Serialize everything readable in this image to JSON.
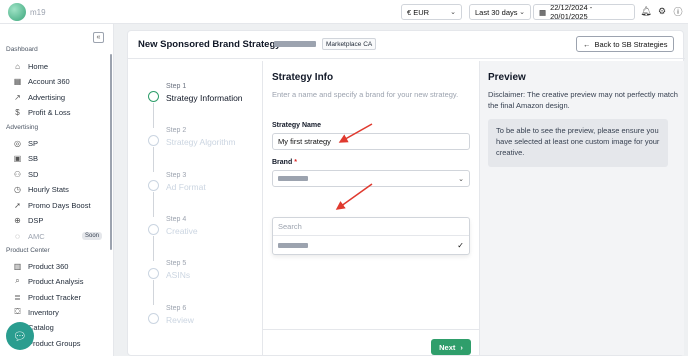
{
  "topbar": {
    "logo_text": "m19",
    "currency": "€ EUR",
    "date_range_preset": "Last 30 days",
    "date_range": "22/12/2024 - 20/01/2025"
  },
  "sidebar": {
    "collapse_icon": "«",
    "sections": [
      {
        "label": "Dashboard",
        "items": [
          {
            "label": "Home",
            "icon": "home-icon",
            "glyph": "⌂"
          },
          {
            "label": "Account 360",
            "icon": "grid-icon",
            "glyph": "▦"
          },
          {
            "label": "Advertising",
            "icon": "trend-icon",
            "glyph": "↗"
          },
          {
            "label": "Profit & Loss",
            "icon": "dollar-icon",
            "glyph": "$"
          }
        ]
      },
      {
        "label": "Advertising",
        "items": [
          {
            "label": "SP",
            "icon": "target-icon",
            "glyph": "◎"
          },
          {
            "label": "SB",
            "icon": "sb-icon",
            "glyph": "▣"
          },
          {
            "label": "SD",
            "icon": "sd-icon",
            "glyph": "⚇"
          },
          {
            "label": "Hourly Stats",
            "icon": "clock-icon",
            "glyph": "◷"
          },
          {
            "label": "Promo Days Boost",
            "icon": "rocket-icon",
            "glyph": "➚"
          },
          {
            "label": "DSP",
            "icon": "globe-icon",
            "glyph": "⊕"
          },
          {
            "label": "AMC",
            "icon": "amc-icon",
            "glyph": "◌",
            "badge": "Soon"
          }
        ]
      },
      {
        "label": "Product Center",
        "items": [
          {
            "label": "Product 360",
            "icon": "product-icon",
            "glyph": "▥"
          },
          {
            "label": "Product Analysis",
            "icon": "analysis-icon",
            "glyph": "⌕"
          },
          {
            "label": "Product Tracker",
            "icon": "tracker-icon",
            "glyph": "≣"
          },
          {
            "label": "Inventory",
            "icon": "inventory-icon",
            "glyph": "⛋"
          },
          {
            "label": "Catalog",
            "icon": "catalog-icon",
            "glyph": "☰"
          },
          {
            "label": "Product Groups",
            "icon": "groups-icon",
            "glyph": "⧉"
          }
        ]
      }
    ]
  },
  "header": {
    "title": "New Sponsored Brand Strategy",
    "marketplace": "Marketplace CA",
    "back_label": "Back to SB Strategies"
  },
  "steps": [
    {
      "num": "Step 1",
      "name": "Strategy Information",
      "active": true
    },
    {
      "num": "Step 2",
      "name": "Strategy Algorithm",
      "active": false
    },
    {
      "num": "Step 3",
      "name": "Ad Format",
      "active": false
    },
    {
      "num": "Step 4",
      "name": "Creative",
      "active": false
    },
    {
      "num": "Step 5",
      "name": "ASINs",
      "active": false
    },
    {
      "num": "Step 6",
      "name": "Review",
      "active": false
    }
  ],
  "form": {
    "title": "Strategy Info",
    "description": "Enter a name and specify a brand for your new strategy.",
    "name_label": "Strategy Name",
    "name_value": "My first strategy",
    "brand_label": "Brand",
    "brand_required": "*",
    "search_placeholder": "Search",
    "next_label": "Next"
  },
  "preview": {
    "title": "Preview",
    "disclaimer": "Disclaimer: The creative preview may not perfectly match the final Amazon design.",
    "notice": "To be able to see the preview, please ensure you have selected at least one custom image for your creative."
  },
  "colors": {
    "accent": "#2f9e6b",
    "chat": "#2a9d8f",
    "annotation_arrow": "#e03a2f"
  }
}
